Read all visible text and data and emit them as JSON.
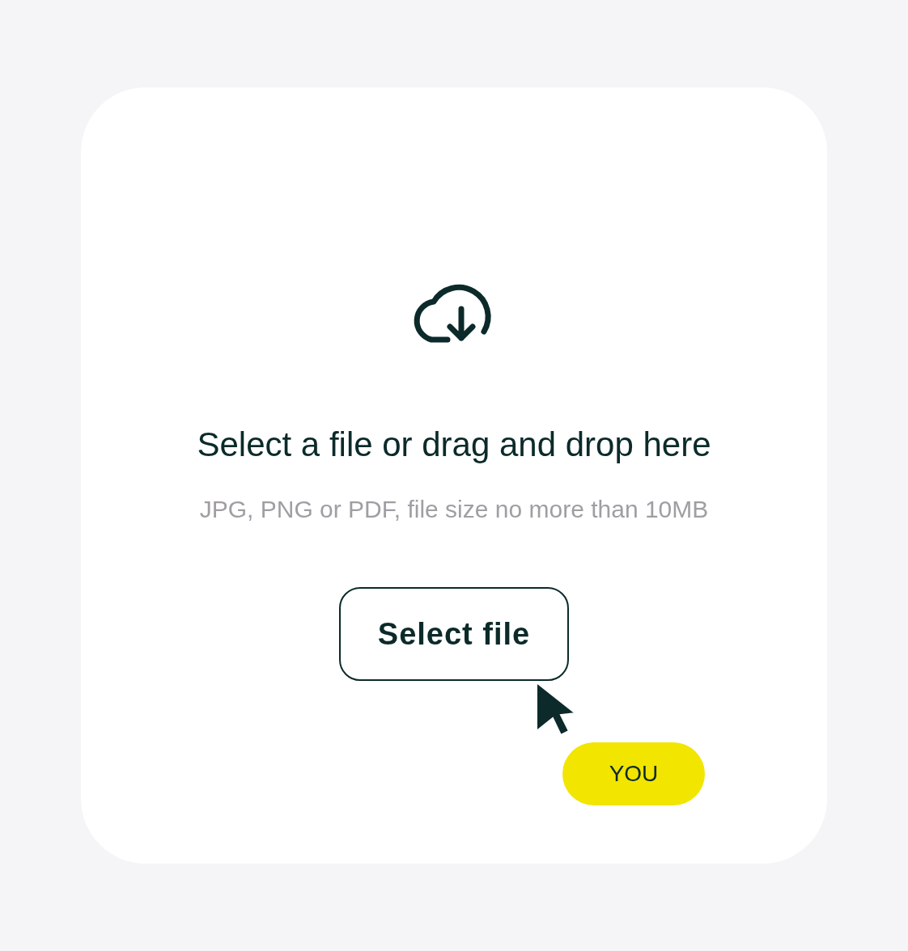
{
  "upload": {
    "title": "Select a file or drag and drop here",
    "hint": "JPG, PNG or PDF, file size no more than 10MB",
    "button": "Select file"
  },
  "cursor_badge": {
    "label": "YOU"
  }
}
